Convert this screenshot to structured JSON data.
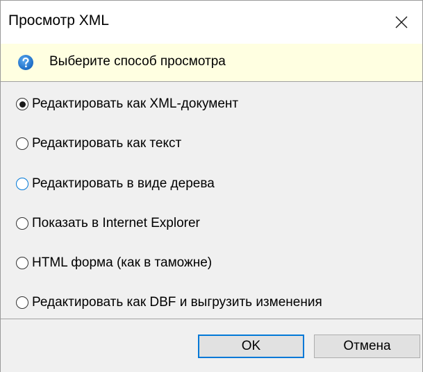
{
  "window": {
    "title": "Просмотр XML"
  },
  "info": {
    "icon": "question-icon",
    "text": "Выберите способ просмотра"
  },
  "options": [
    {
      "label": "Редактировать как XML-документ",
      "selected": true
    },
    {
      "label": "Редактировать как текст",
      "selected": false
    },
    {
      "label": "Редактировать в виде дерева",
      "selected": false,
      "focused": true
    },
    {
      "label": "Показать в Internet Explorer",
      "selected": false
    },
    {
      "label": "HTML форма (как в таможне)",
      "selected": false
    },
    {
      "label": "Редактировать как DBF и выгрузить изменения",
      "selected": false
    }
  ],
  "buttons": {
    "ok_label": "OK",
    "cancel_label": "Отмена"
  },
  "colors": {
    "accent": "#0078d7",
    "info_background": "#ffffe1",
    "dialog_background": "#f0f0f0"
  }
}
